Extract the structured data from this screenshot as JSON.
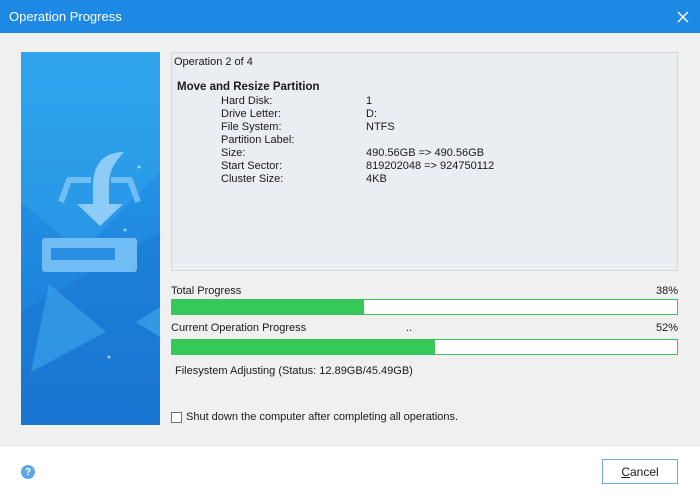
{
  "window": {
    "title": "Operation Progress"
  },
  "operation": {
    "counter": "Operation 2 of 4",
    "title": "Move and Resize Partition",
    "details": [
      {
        "label": "Hard Disk:",
        "value": "1"
      },
      {
        "label": "Drive Letter:",
        "value": "D:"
      },
      {
        "label": "File System:",
        "value": "NTFS"
      },
      {
        "label": "Partition Label:",
        "value": ""
      },
      {
        "label": "Size:",
        "value": "490.56GB => 490.56GB"
      },
      {
        "label": "Start Sector:",
        "value": "819202048 => 924750112"
      },
      {
        "label": "Cluster Size:",
        "value": "4KB"
      }
    ]
  },
  "total_progress": {
    "label": "Total Progress",
    "percent_text": "38%",
    "fraction": 0.38
  },
  "current_progress": {
    "label": "Current Operation Progress",
    "dots": "..",
    "percent_text": "52%",
    "fraction": 0.52
  },
  "status": "Filesystem Adjusting (Status: 12.89GB/45.49GB)",
  "shutdown_option": {
    "label": "Shut down the computer after completing all operations.",
    "checked": false
  },
  "footer": {
    "help_symbol": "?",
    "cancel_label": "Cancel"
  },
  "icons": {
    "close": "close-icon",
    "help": "help-icon",
    "banner": "download-to-drive-icon"
  },
  "colors": {
    "titlebar": "#1e88e5",
    "banner": "#1f86de",
    "progress_fill": "#35c95a",
    "progress_border": "#3ec45a"
  }
}
